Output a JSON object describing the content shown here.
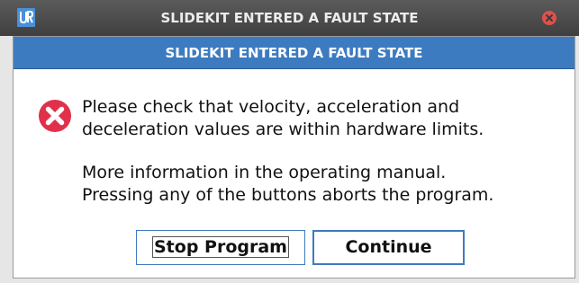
{
  "window": {
    "title": "SLIDEKIT ENTERED A FAULT STATE",
    "logo_icon": "ur-logo-icon",
    "close_icon": "close-icon"
  },
  "dialog": {
    "header": "SLIDEKIT ENTERED A FAULT STATE",
    "icon": "error-icon",
    "message_lines": [
      "Please check that velocity, acceleration and",
      "deceleration values are within hardware limits.",
      "",
      "More information in the operating manual.",
      "Pressing any of the buttons aborts the program."
    ],
    "buttons": {
      "stop_label": "Stop Program",
      "continue_label": "Continue"
    }
  },
  "colors": {
    "titlebar": "#4a4a4a",
    "header_blue": "#3d7bc0",
    "error_red": "#e0304a",
    "close_red": "#e0504a"
  }
}
